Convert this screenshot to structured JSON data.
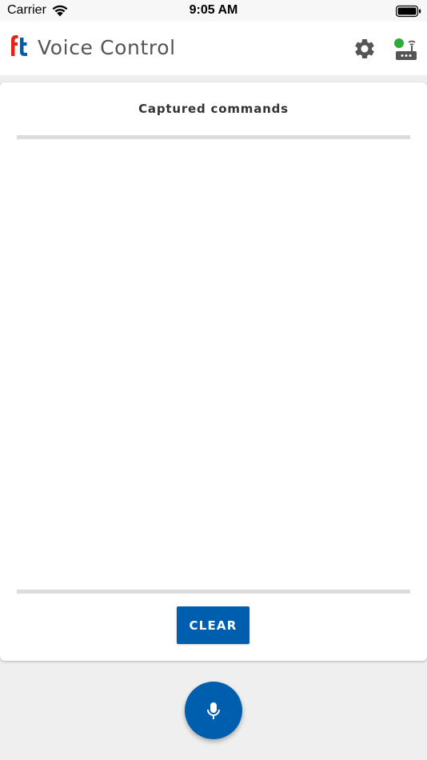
{
  "status_bar": {
    "carrier": "Carrier",
    "time": "9:05 AM"
  },
  "app_bar": {
    "logo_text": "ft",
    "title": "Voice Control",
    "settings_icon": "gear-icon",
    "connection_icon": "router-connected-icon",
    "connection_status_color": "#2eaa3c"
  },
  "card": {
    "title": "Captured commands",
    "commands": [],
    "clear_label": "CLEAR"
  },
  "fab": {
    "icon": "microphone-icon"
  },
  "colors": {
    "accent": "#005eae",
    "logo_red": "#e2231a",
    "logo_blue": "#005eae",
    "background": "#efefef"
  }
}
